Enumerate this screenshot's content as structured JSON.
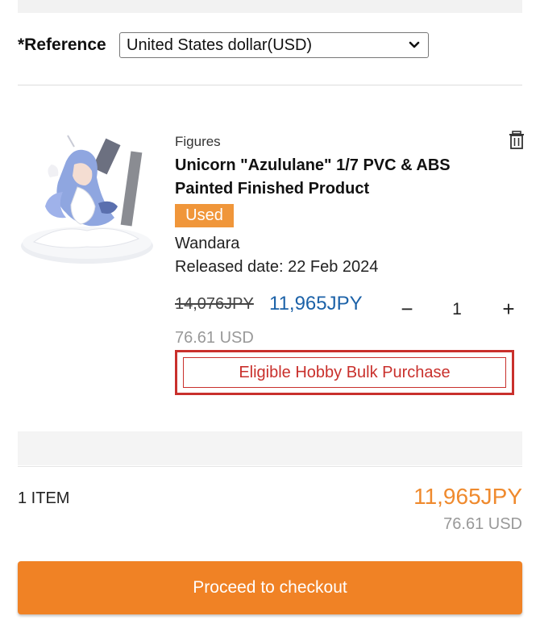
{
  "reference": {
    "label": "*Reference",
    "currency_selected": "United States dollar(USD)"
  },
  "cart_item": {
    "category": "Figures",
    "title": "Unicorn \"Azululane\" 1/7 PVC & ABS Painted Finished Product",
    "condition_badge": "Used",
    "maker": "Wandara",
    "release_date": "Released date: 22 Feb 2024",
    "original_price": "14,076JPY",
    "sale_price": "11,965JPY",
    "usd_price": "76.61 USD",
    "quantity": "1",
    "minus_symbol": "−",
    "plus_symbol": "+",
    "bulk_purchase_label": "Eligible Hobby Bulk Purchase"
  },
  "summary": {
    "item_count": "1 ITEM",
    "total_jpy": "11,965JPY",
    "total_usd": "76.61 USD"
  },
  "checkout": {
    "button_label": "Proceed to checkout"
  },
  "colors": {
    "accent_orange": "#f08225",
    "price_blue": "#1c62a8",
    "bulk_red": "#c9302c",
    "badge_orange": "#f0963a"
  },
  "icons": {
    "select_chevron": "chevron-down-icon",
    "delete": "trash-icon"
  }
}
